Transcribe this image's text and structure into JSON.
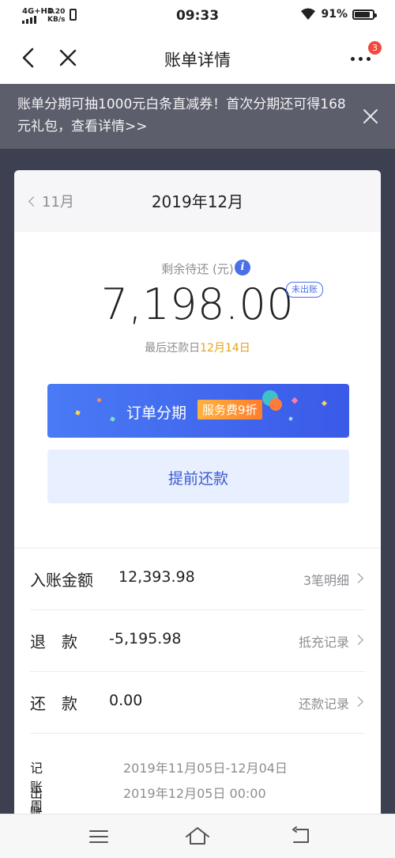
{
  "status_bar": {
    "network": "4G+HD",
    "speed_value": "4.20",
    "speed_unit": "KB/s",
    "time": "09:33",
    "battery": "91%"
  },
  "header": {
    "title": "账单详情",
    "notification_count": "3"
  },
  "promo": {
    "text": "账单分期可抽1000元白条直减券！首次分期还可得168元礼包，查看详情>>"
  },
  "bill": {
    "prev_month": "11月",
    "current_month": "2019年12月",
    "remaining_label": "剩余待还 (元)",
    "amount": "7,198.00",
    "status_tag": "未出账",
    "due_prefix": "最后还款日",
    "due_date": "12月14日",
    "installment_label": "订单分期",
    "installment_tag": "服务费9折",
    "prepay_label": "提前还款"
  },
  "rows": [
    {
      "label": "入账金额",
      "value": "12,393.98",
      "link": "3笔明细"
    },
    {
      "label": "退　款",
      "value": "-5,195.98",
      "link": "抵充记录"
    },
    {
      "label": "还　款",
      "value": "0.00",
      "link": "还款记录"
    }
  ],
  "meta": [
    {
      "key": "记账周期",
      "value": "2019年11月05日-12月04日"
    },
    {
      "key": "出账日",
      "value": "2019年12月05日 00:00"
    }
  ],
  "colors": {
    "accent": "#4a6fe8",
    "due_highlight": "#e5a11a",
    "badge": "#f2493c",
    "promo_bg": "#5c5f6b"
  }
}
